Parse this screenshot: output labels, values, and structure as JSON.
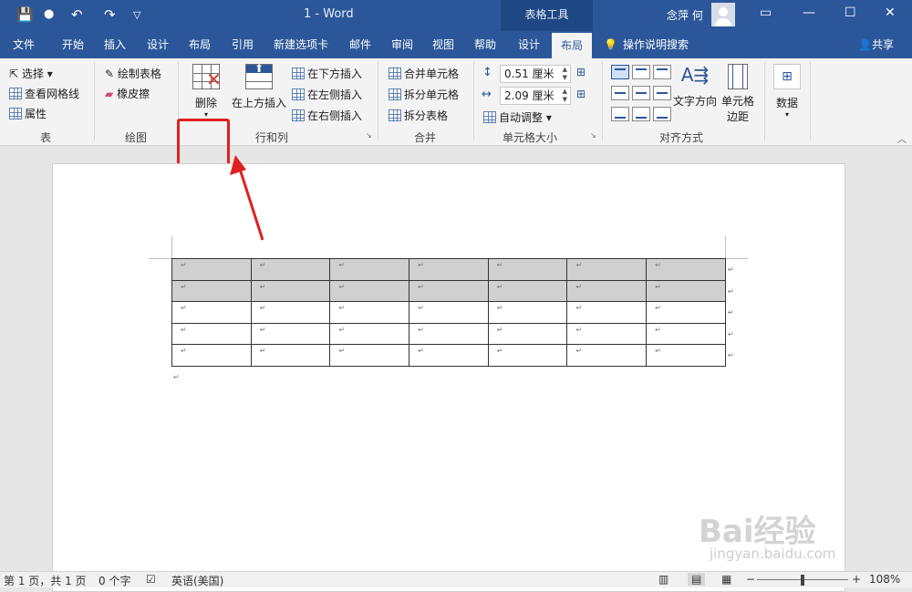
{
  "titlebar": {
    "doc_title": "1 - Word",
    "context_tab": "表格工具",
    "user_name": "念萍 何"
  },
  "tabs": [
    "文件",
    "开始",
    "插入",
    "设计",
    "布局",
    "引用",
    "新建选项卡",
    "邮件",
    "审阅",
    "视图",
    "帮助",
    "设计",
    "布局"
  ],
  "active_tab_index": 12,
  "search_label": "操作说明搜索",
  "share_label": "共享",
  "ribbon": {
    "table_group": {
      "label": "表",
      "select": "选择",
      "gridlines": "查看网格线",
      "properties": "属性"
    },
    "draw_group": {
      "label": "绘图",
      "draw_table": "绘制表格",
      "eraser": "橡皮擦"
    },
    "rows_cols_group": {
      "label": "行和列",
      "delete": "删除",
      "insert_above": "在上方插入",
      "insert_below": "在下方插入",
      "insert_left": "在左侧插入",
      "insert_right": "在右侧插入"
    },
    "merge_group": {
      "label": "合并",
      "merge_cells": "合并单元格",
      "split_cells": "拆分单元格",
      "split_table": "拆分表格"
    },
    "cell_size_group": {
      "label": "单元格大小",
      "height": "0.51 厘米",
      "width": "2.09 厘米",
      "autofit": "自动调整"
    },
    "align_group": {
      "label": "对齐方式",
      "text_direction": "文字方向",
      "cell_margins_1": "单元格",
      "cell_margins_2": "边距"
    },
    "data_group": {
      "label": "数据"
    }
  },
  "document": {
    "rows": 5,
    "cols": 7,
    "shaded_rows": 2,
    "cell_mark": "↵"
  },
  "statusbar": {
    "page": "第 1 页，共 1 页",
    "words": "0 个字",
    "language": "英语(美国)",
    "zoom_minus": "−",
    "zoom_plus": "+",
    "zoom": "108%"
  },
  "watermark": {
    "text": "Bai经验",
    "sub": "jingyan.baidu.com"
  },
  "colors": {
    "brand": "#2b579a",
    "highlight": "#e02020"
  }
}
